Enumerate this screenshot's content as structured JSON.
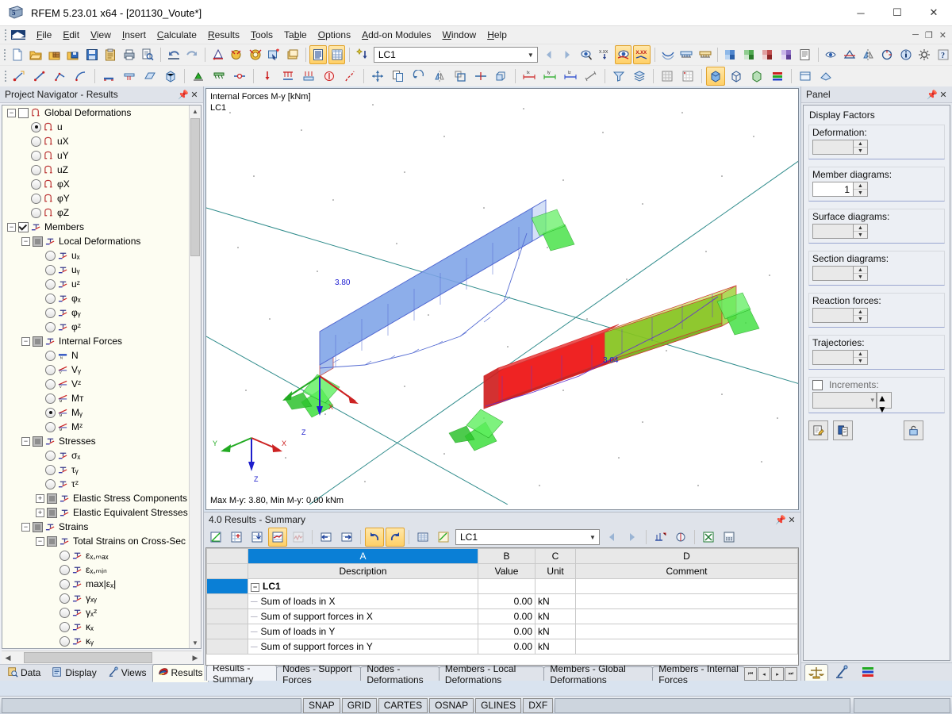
{
  "window": {
    "title": "RFEM 5.23.01 x64 - [201130_Voute*]",
    "app_icon": "rfem-logo-icon",
    "minimize": "─",
    "maximize": "☐",
    "close": "✕"
  },
  "menubar": {
    "items": [
      {
        "label": "File",
        "accel": "F"
      },
      {
        "label": "Edit",
        "accel": "E"
      },
      {
        "label": "View",
        "accel": "V"
      },
      {
        "label": "Insert",
        "accel": "I"
      },
      {
        "label": "Calculate",
        "accel": "C"
      },
      {
        "label": "Results",
        "accel": "R"
      },
      {
        "label": "Tools",
        "accel": "T"
      },
      {
        "label": "Table",
        "accel": "b"
      },
      {
        "label": "Options",
        "accel": "O"
      },
      {
        "label": "Add-on Modules",
        "accel": "A"
      },
      {
        "label": "Window",
        "accel": "W"
      },
      {
        "label": "Help",
        "accel": "H"
      }
    ],
    "doc_minimize": "─",
    "doc_restore": "❐",
    "doc_close": "✕"
  },
  "toolbar_main": {
    "load_case_value": "LC1",
    "buttons": [
      {
        "name": "new-file-icon",
        "title": "New"
      },
      {
        "name": "open-file-icon",
        "title": "Open"
      },
      {
        "name": "open-package-icon",
        "title": "Open package"
      },
      {
        "name": "save-package-icon",
        "title": "Save package"
      },
      {
        "name": "save-icon",
        "title": "Save"
      },
      {
        "name": "clipboard-icon",
        "title": "Clipboard"
      },
      {
        "name": "print-icon",
        "title": "Print"
      },
      {
        "name": "print-preview-icon",
        "title": "Print preview"
      },
      {
        "name": "undo-icon",
        "title": "Undo"
      },
      {
        "name": "redo-icon",
        "title": "Redo"
      },
      {
        "name": "render-model-icon",
        "title": "Render model"
      },
      {
        "name": "calculate-icon",
        "title": "Calculate"
      },
      {
        "name": "calculate-all-icon",
        "title": "Calculate all"
      },
      {
        "name": "select-plus-icon",
        "title": "Select"
      },
      {
        "name": "window-view-icon",
        "title": "View"
      },
      {
        "name": "table-view-icon",
        "title": "Tables"
      },
      {
        "name": "table-grid-icon",
        "title": "Grid"
      },
      {
        "name": "load-wizard-icon",
        "title": "Load wizard"
      }
    ],
    "buttons_right": [
      {
        "name": "prev-lc-icon",
        "title": "Previous load case"
      },
      {
        "name": "next-lc-icon",
        "title": "Next load case"
      },
      {
        "name": "result-values-icon",
        "title": "Result values"
      },
      {
        "name": "result-label-icon",
        "title": "Values on surfaces"
      },
      {
        "name": "show-results-icon",
        "title": "Show results"
      },
      {
        "name": "result-values-xxx-icon",
        "title": "Result values x.xx"
      },
      {
        "name": "deformation-icon",
        "title": "Deformation"
      },
      {
        "name": "support-reactions-icon",
        "title": "Support reactions"
      },
      {
        "name": "support-forces-icon",
        "title": "Support forces"
      },
      {
        "name": "surface-results-icon",
        "title": "Surface results"
      },
      {
        "name": "sections-icon",
        "title": "Sections"
      },
      {
        "name": "result-diagram-icon",
        "title": "Result diagram"
      },
      {
        "name": "result-combination-icon",
        "title": "Result combination"
      },
      {
        "name": "printout-report-icon",
        "title": "Printout report"
      },
      {
        "name": "visibility-icon",
        "title": "Visibility"
      },
      {
        "name": "clipping-icon",
        "title": "Clipping"
      },
      {
        "name": "info-icon",
        "title": "Info"
      },
      {
        "name": "mirror-icon",
        "title": "Mirror"
      },
      {
        "name": "rotate-icon",
        "title": "Rotate"
      },
      {
        "name": "settings-icon",
        "title": "Settings"
      },
      {
        "name": "help-icon",
        "title": "Help"
      }
    ]
  },
  "toolbar_second": {
    "buttons": [
      {
        "name": "line-tool-icon"
      },
      {
        "name": "polyline-tool-icon"
      },
      {
        "name": "arc-tool-icon"
      },
      {
        "name": "circle-tool-icon"
      },
      {
        "name": "nurbs-tool-icon"
      },
      {
        "name": "member-tool-icon"
      },
      {
        "name": "surface-tool-icon"
      },
      {
        "name": "solid-tool-icon"
      },
      {
        "name": "node-support-icon"
      },
      {
        "name": "line-support-icon"
      },
      {
        "name": "member-hinge-icon"
      },
      {
        "name": "nodal-load-icon"
      },
      {
        "name": "member-load-icon"
      },
      {
        "name": "surface-load-icon"
      },
      {
        "name": "free-load-icon"
      },
      {
        "name": "imperfection-icon"
      },
      {
        "name": "move-icon"
      },
      {
        "name": "copy-icon"
      },
      {
        "name": "rotate-copy-icon"
      },
      {
        "name": "mirror-copy-icon"
      },
      {
        "name": "scale-icon"
      },
      {
        "name": "divide-icon"
      },
      {
        "name": "extrude-icon"
      },
      {
        "name": "dimension-x-icon"
      },
      {
        "name": "dimension-y-icon"
      },
      {
        "name": "dimension-z-icon"
      },
      {
        "name": "dimension-any-icon"
      },
      {
        "name": "filter-icon"
      },
      {
        "name": "layers-icon"
      },
      {
        "name": "grid-snap-icon"
      },
      {
        "name": "render-solid-icon"
      },
      {
        "name": "render-wire-icon"
      },
      {
        "name": "render-transparent-icon"
      },
      {
        "name": "colors-icon"
      },
      {
        "name": "view-normal-icon"
      },
      {
        "name": "view-iso-icon"
      }
    ]
  },
  "navigator": {
    "title": "Project Navigator - Results",
    "pin_icon": "pin-icon",
    "close_icon": "close-icon",
    "tree": [
      {
        "id": "global-deformations",
        "label": "Global Deformations",
        "depth": 0,
        "ctrl": "checkbox",
        "state": "unchecked",
        "expander": "minus",
        "icon": "global-deformation-icon"
      },
      {
        "id": "u",
        "label": "u",
        "depth": 1,
        "ctrl": "radio",
        "state": "selected",
        "icon": "global-deformation-icon"
      },
      {
        "id": "ux",
        "label": "uX",
        "depth": 1,
        "ctrl": "radio",
        "state": "unselected",
        "icon": "global-deformation-icon"
      },
      {
        "id": "uy",
        "label": "uY",
        "depth": 1,
        "ctrl": "radio",
        "state": "unselected",
        "icon": "global-deformation-icon"
      },
      {
        "id": "uz",
        "label": "uZ",
        "depth": 1,
        "ctrl": "radio",
        "state": "unselected",
        "icon": "global-deformation-icon"
      },
      {
        "id": "phix",
        "label": "φX",
        "depth": 1,
        "ctrl": "radio",
        "state": "unselected",
        "icon": "global-deformation-icon"
      },
      {
        "id": "phiy",
        "label": "φY",
        "depth": 1,
        "ctrl": "radio",
        "state": "unselected",
        "icon": "global-deformation-icon"
      },
      {
        "id": "phiz",
        "label": "φZ",
        "depth": 1,
        "ctrl": "radio",
        "state": "unselected",
        "icon": "global-deformation-icon"
      },
      {
        "id": "members",
        "label": "Members",
        "depth": 0,
        "ctrl": "checkbox",
        "state": "checked",
        "expander": "minus",
        "icon": "member-icon"
      },
      {
        "id": "local-deformations",
        "label": "Local Deformations",
        "depth": 1,
        "ctrl": "checkbox",
        "state": "grey",
        "expander": "minus",
        "icon": "member-icon"
      },
      {
        "id": "l-ux",
        "label": "uₓ",
        "depth": 2,
        "ctrl": "radio",
        "state": "unselected",
        "icon": "member-icon"
      },
      {
        "id": "l-uy",
        "label": "uᵧ",
        "depth": 2,
        "ctrl": "radio",
        "state": "unselected",
        "icon": "member-icon"
      },
      {
        "id": "l-uz",
        "label": "uᶻ",
        "depth": 2,
        "ctrl": "radio",
        "state": "unselected",
        "icon": "member-icon"
      },
      {
        "id": "l-phix",
        "label": "φₓ",
        "depth": 2,
        "ctrl": "radio",
        "state": "unselected",
        "icon": "member-icon"
      },
      {
        "id": "l-phiy",
        "label": "φᵧ",
        "depth": 2,
        "ctrl": "radio",
        "state": "unselected",
        "icon": "member-icon"
      },
      {
        "id": "l-phiz",
        "label": "φᶻ",
        "depth": 2,
        "ctrl": "radio",
        "state": "unselected",
        "icon": "member-icon"
      },
      {
        "id": "internal-forces",
        "label": "Internal Forces",
        "depth": 1,
        "ctrl": "checkbox",
        "state": "grey",
        "expander": "minus",
        "icon": "member-icon"
      },
      {
        "id": "N",
        "label": "N",
        "depth": 2,
        "ctrl": "radio",
        "state": "unselected",
        "icon": "normal-force-icon"
      },
      {
        "id": "Vy",
        "label": "Vᵧ",
        "depth": 2,
        "ctrl": "radio",
        "state": "unselected",
        "icon": "shear-force-icon"
      },
      {
        "id": "Vz",
        "label": "Vᶻ",
        "depth": 2,
        "ctrl": "radio",
        "state": "unselected",
        "icon": "shear-force-icon"
      },
      {
        "id": "MT",
        "label": "Mᴛ",
        "depth": 2,
        "ctrl": "radio",
        "state": "unselected",
        "icon": "moment-icon"
      },
      {
        "id": "My",
        "label": "Mᵧ",
        "depth": 2,
        "ctrl": "radio",
        "state": "selected",
        "icon": "moment-icon"
      },
      {
        "id": "Mz",
        "label": "Mᶻ",
        "depth": 2,
        "ctrl": "radio",
        "state": "unselected",
        "icon": "moment-icon"
      },
      {
        "id": "stresses",
        "label": "Stresses",
        "depth": 1,
        "ctrl": "checkbox",
        "state": "grey",
        "expander": "minus",
        "icon": "member-icon"
      },
      {
        "id": "sigx",
        "label": "σₓ",
        "depth": 2,
        "ctrl": "radio",
        "state": "unselected",
        "icon": "member-icon"
      },
      {
        "id": "tauy",
        "label": "τᵧ",
        "depth": 2,
        "ctrl": "radio",
        "state": "unselected",
        "icon": "member-icon"
      },
      {
        "id": "tauz",
        "label": "τᶻ",
        "depth": 2,
        "ctrl": "radio",
        "state": "unselected",
        "icon": "member-icon"
      },
      {
        "id": "elastic-stress-components",
        "label": "Elastic Stress Components",
        "depth": 2,
        "ctrl": "checkbox",
        "state": "grey",
        "expander": "plus",
        "icon": "member-icon"
      },
      {
        "id": "elastic-equivalent-stresses",
        "label": "Elastic Equivalent Stresses",
        "depth": 2,
        "ctrl": "checkbox",
        "state": "grey",
        "expander": "plus",
        "icon": "member-icon"
      },
      {
        "id": "strains",
        "label": "Strains",
        "depth": 1,
        "ctrl": "checkbox",
        "state": "grey",
        "expander": "minus",
        "icon": "member-icon"
      },
      {
        "id": "total-strains",
        "label": "Total Strains on Cross-Sec",
        "depth": 2,
        "ctrl": "checkbox",
        "state": "grey",
        "expander": "minus",
        "icon": "member-icon"
      },
      {
        "id": "eps-max",
        "label": "εₓ,ₘₐₓ",
        "depth": 3,
        "ctrl": "radio",
        "state": "unselected",
        "icon": "member-icon"
      },
      {
        "id": "eps-min",
        "label": "εₓ,ₘᵢₙ",
        "depth": 3,
        "ctrl": "radio",
        "state": "unselected",
        "icon": "member-icon"
      },
      {
        "id": "eps-abs",
        "label": "max|εₓ|",
        "depth": 3,
        "ctrl": "radio",
        "state": "unselected",
        "icon": "member-icon"
      },
      {
        "id": "gxy",
        "label": "γₓᵧ",
        "depth": 3,
        "ctrl": "radio",
        "state": "unselected",
        "icon": "member-icon"
      },
      {
        "id": "gxz",
        "label": "γₓᶻ",
        "depth": 3,
        "ctrl": "radio",
        "state": "unselected",
        "icon": "member-icon"
      },
      {
        "id": "kx",
        "label": "κₓ",
        "depth": 3,
        "ctrl": "radio",
        "state": "unselected",
        "icon": "member-icon"
      },
      {
        "id": "ky",
        "label": "κᵧ",
        "depth": 3,
        "ctrl": "radio",
        "state": "unselected",
        "icon": "member-icon"
      },
      {
        "id": "kz",
        "label": "κᶻ",
        "depth": 3,
        "ctrl": "radio",
        "state": "unselected",
        "icon": "member-icon"
      }
    ],
    "tabs": [
      {
        "id": "data",
        "label": "Data",
        "icon": "data-icon",
        "active": false
      },
      {
        "id": "display",
        "label": "Display",
        "icon": "display-icon",
        "active": false
      },
      {
        "id": "views",
        "label": "Views",
        "icon": "views-icon",
        "active": false
      },
      {
        "id": "results",
        "label": "Results",
        "icon": "results-icon",
        "active": true
      }
    ]
  },
  "viewport": {
    "caption_line1": "Internal Forces M-y [kNm]",
    "caption_line2": "LC1",
    "footer": "Max M-y: 3.80, Min M-y: 0.00 kNm",
    "axis": {
      "x": "X",
      "y": "Y",
      "z": "Z"
    },
    "member_labels": [
      {
        "value": "3.80",
        "color": "#1818d0"
      },
      {
        "value": "3.04",
        "color": "#1818d0"
      }
    ],
    "local_axis": {
      "x": "X",
      "z": "Z"
    },
    "colors": {
      "beam_blue_fill": "#7ea3e8",
      "beam_blue_edge": "#2c46c8",
      "beam_red_fill": "#ee1111",
      "beam_green_fill": "#77bb00",
      "support_green": "#29d629",
      "background": "#ffffff",
      "axis_line": "#2e8b8b"
    }
  },
  "table_window": {
    "title": "4.0 Results - Summary",
    "pin_icon": "pin-icon",
    "close_icon": "close-icon",
    "load_case_value": "LC1",
    "toolbar_buttons": [
      {
        "name": "table-edit-icon",
        "active": false
      },
      {
        "name": "table-insert-icon",
        "active": false
      },
      {
        "name": "table-import-icon",
        "active": false
      },
      {
        "name": "table-results-icon",
        "active": true
      },
      {
        "name": "table-chart-icon",
        "active": false
      },
      {
        "name": "table-prev-icon",
        "active": false
      },
      {
        "name": "table-next-icon",
        "active": false
      },
      {
        "name": "table-undo-icon",
        "active": true
      },
      {
        "name": "table-redo-icon",
        "active": true
      },
      {
        "name": "table-selection-icon",
        "active": false
      },
      {
        "name": "table-filter-icon",
        "active": false
      },
      {
        "name": "table-first-icon",
        "active": false
      },
      {
        "name": "table-last-icon",
        "active": false
      },
      {
        "name": "table-settings-icon",
        "active": false
      },
      {
        "name": "table-print-icon",
        "active": false
      },
      {
        "name": "table-excel-icon",
        "active": false
      },
      {
        "name": "table-calc-icon",
        "active": false
      }
    ],
    "column_letters": [
      "A",
      "B",
      "C",
      "D"
    ],
    "headers": [
      "Description",
      "Value",
      "Unit",
      "Comment"
    ],
    "rows": [
      {
        "type": "group",
        "description": "LC1",
        "value": "",
        "unit": "",
        "comment": "",
        "selected": true
      },
      {
        "type": "data",
        "description": "Sum of loads in X",
        "value": "0.00",
        "unit": "kN",
        "comment": ""
      },
      {
        "type": "data",
        "description": "Sum of support forces in X",
        "value": "0.00",
        "unit": "kN",
        "comment": ""
      },
      {
        "type": "data",
        "description": "Sum of loads in Y",
        "value": "0.00",
        "unit": "kN",
        "comment": ""
      },
      {
        "type": "data",
        "description": "Sum of support forces in Y",
        "value": "0.00",
        "unit": "kN",
        "comment": ""
      }
    ],
    "tabs": [
      {
        "label": "Results - Summary",
        "active": true
      },
      {
        "label": "Nodes - Support Forces",
        "active": false
      },
      {
        "label": "Nodes - Deformations",
        "active": false
      },
      {
        "label": "Members - Local Deformations",
        "active": false
      },
      {
        "label": "Members - Global Deformations",
        "active": false
      },
      {
        "label": "Members - Internal Forces",
        "active": false
      }
    ],
    "tab_nav": [
      "⏮",
      "◂",
      "▸",
      "⏭"
    ]
  },
  "panel": {
    "title": "Panel",
    "pin_icon": "pin-icon",
    "close_icon": "close-icon",
    "section_title": "Display Factors",
    "fields": [
      {
        "id": "deformation",
        "label": "Deformation:",
        "value": "",
        "enabled": false
      },
      {
        "id": "member-diagrams",
        "label": "Member diagrams:",
        "value": "1",
        "enabled": true
      },
      {
        "id": "surface-diagrams",
        "label": "Surface diagrams:",
        "value": "",
        "enabled": false
      },
      {
        "id": "section-diagrams",
        "label": "Section diagrams:",
        "value": "",
        "enabled": false
      },
      {
        "id": "reaction-forces",
        "label": "Reaction forces:",
        "value": "",
        "enabled": false
      },
      {
        "id": "trajectories",
        "label": "Trajectories:",
        "value": "",
        "enabled": false
      }
    ],
    "increments": {
      "label": "Increments:",
      "checked": false,
      "value": ""
    },
    "buttons": [
      {
        "name": "edit-panel-button",
        "icon": "edit-pencil-icon"
      },
      {
        "name": "copy-panel-button",
        "icon": "copy-pages-icon"
      },
      {
        "name": "lock-panel-button",
        "icon": "lock-open-icon"
      }
    ],
    "tabs": [
      {
        "id": "factors",
        "icon": "scales-icon",
        "active": true
      },
      {
        "id": "sections",
        "icon": "microscope-icon",
        "active": false
      },
      {
        "id": "colors",
        "icon": "color-bars-icon",
        "active": false
      }
    ]
  },
  "statusbar": {
    "cells": [
      "SNAP",
      "GRID",
      "CARTES",
      "OSNAP",
      "GLINES",
      "DXF"
    ]
  }
}
